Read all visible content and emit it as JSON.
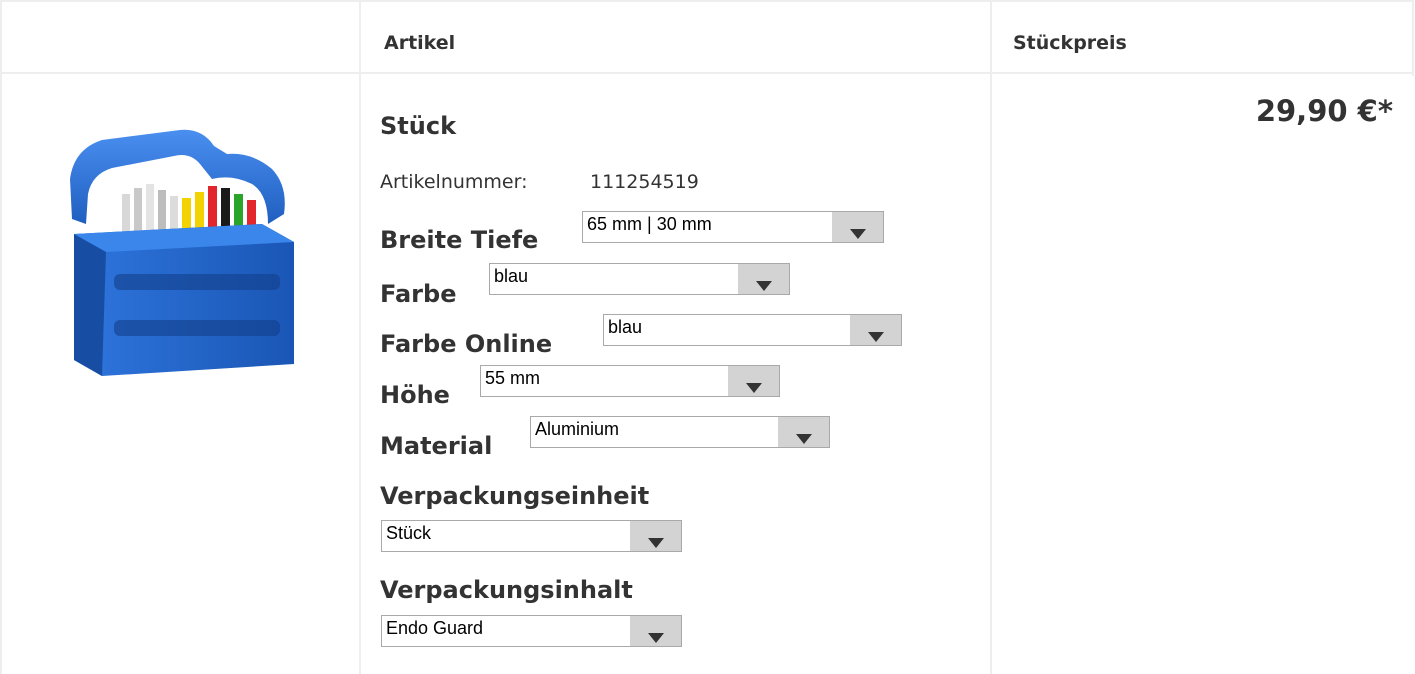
{
  "table": {
    "col_article": "Artikel",
    "col_unit_price": "Stückpreis"
  },
  "product": {
    "title": "Stück",
    "article_number_label": "Artikelnummer:",
    "article_number": "111254519",
    "price": "29,90 €*",
    "image_icon": "endo-file-holder-blue"
  },
  "options": [
    {
      "label": "Breite Tiefe",
      "value": "65 mm | 30 mm"
    },
    {
      "label": "Farbe",
      "value": "blau"
    },
    {
      "label": "Farbe Online",
      "value": "blau"
    },
    {
      "label": "Höhe",
      "value": "55 mm"
    },
    {
      "label": "Material",
      "value": "Aluminium"
    },
    {
      "label": "Verpackungseinheit",
      "value": "Stück"
    },
    {
      "label": "Verpackungsinhalt",
      "value": "Endo Guard"
    }
  ],
  "colors": {
    "border": "#eeeeee",
    "text": "#333333",
    "select_button": "#d3d3d3",
    "product_blue": "#2a6fd0"
  }
}
